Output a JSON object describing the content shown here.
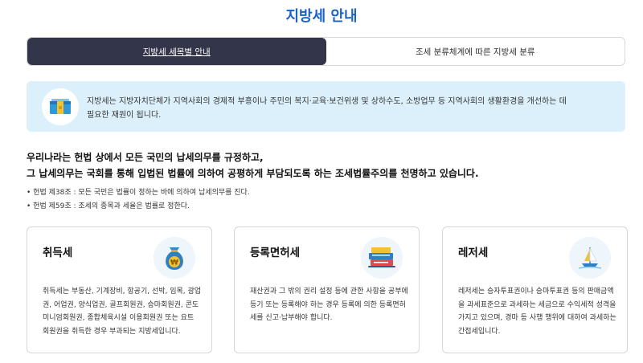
{
  "page": {
    "title": "지방세 안내"
  },
  "tabs": [
    {
      "label": "지방세 세목별 안내",
      "active": true
    },
    {
      "label": "조세 분류체계에 따른 지방세 분류",
      "active": false
    }
  ],
  "info": {
    "icon": "money-box-icon",
    "line1": "지방세는 지방자치단체가 지역사회의 경제적 부흥이나 주민의 복지·교육·보건위생 및 상하수도, 소방업무 등 지역사회의 생활환경을 개선하는 데",
    "line2": "필요한 재원이 됩니다."
  },
  "lead": {
    "line1": "우리나라는 헌법 상에서 모든 국민의 납세의무를 규정하고,",
    "line2": "그 납세의무는 국회를 통해 입법된 법률에 의하여 공평하게 부담되도록 하는 조세법률주의를 천명하고 있습니다."
  },
  "articles": [
    "헌법 제38조 : 모든 국민은 법률이 정하는 바에 의하여 납세의무를 진다.",
    "헌법 제59조 : 조세의 종목과 세율은 법률로 정한다."
  ],
  "cards": [
    {
      "title": "취득세",
      "icon": "money-bag-icon",
      "desc": "취득세는 부동산, 기계장비, 항공기, 선박, 임목, 광업권, 어업권, 양식업권, 골프회원권, 승마회원권, 콘도미니엄회원권, 종합체육시설 이용회원권 또는 요트 회원권을 취득한 경우 부과되는 지방세입니다."
    },
    {
      "title": "등록면허세",
      "icon": "documents-icon",
      "desc": "재산권과 그 밖의 권리 설정 등에 관한 사항을 공부에 등기 또는 등록해야 하는 경우 등록에 의한 등록면허세를 신고·납부해야 합니다."
    },
    {
      "title": "레저세",
      "icon": "sailboat-icon",
      "desc": "레저세는 승자투표권이나 승마투표권 등의 판매금액을 과세표준으로 과세하는 세금으로 수익세적 성격을 가지고 있으며, 경마 등 사행 행위에 대하여 과세하는 간접세입니다."
    }
  ]
}
